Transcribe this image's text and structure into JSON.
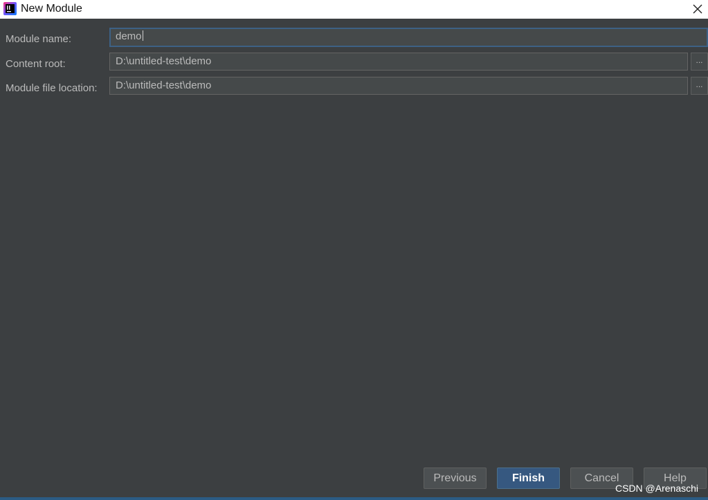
{
  "window": {
    "title": "New Module",
    "app_icon": "intellij-idea-icon",
    "close_icon": "close-icon"
  },
  "form": {
    "module_name": {
      "label": "Module name:",
      "value": "demo"
    },
    "content_root": {
      "label": "Content root:",
      "value": "D:\\untitled-test\\demo",
      "browse_label": "..."
    },
    "module_file_location": {
      "label": "Module file location:",
      "value": "D:\\untitled-test\\demo",
      "browse_label": "..."
    }
  },
  "buttons": {
    "previous": "Previous",
    "finish": "Finish",
    "cancel": "Cancel",
    "help": "Help"
  },
  "watermark": "CSDN @Arenaschi",
  "colors": {
    "background": "#3c3f41",
    "field_background": "#45494a",
    "text": "#bbbbbb",
    "focus_border": "#3d6185",
    "primary_button": "#365880"
  }
}
